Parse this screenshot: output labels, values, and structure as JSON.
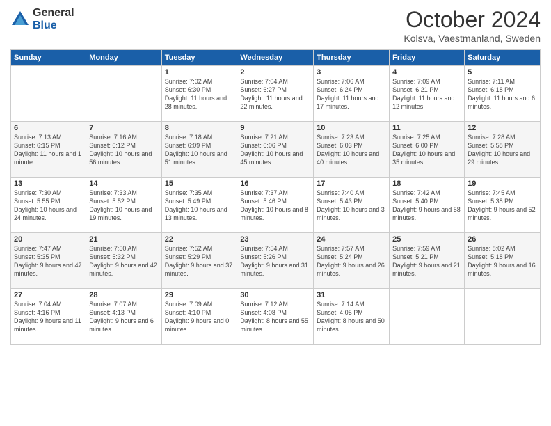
{
  "logo": {
    "general": "General",
    "blue": "Blue"
  },
  "header": {
    "month": "October 2024",
    "location": "Kolsva, Vaestmanland, Sweden"
  },
  "weekdays": [
    "Sunday",
    "Monday",
    "Tuesday",
    "Wednesday",
    "Thursday",
    "Friday",
    "Saturday"
  ],
  "weeks": [
    [
      {
        "day": "",
        "sunrise": "",
        "sunset": "",
        "daylight": ""
      },
      {
        "day": "",
        "sunrise": "",
        "sunset": "",
        "daylight": ""
      },
      {
        "day": "1",
        "sunrise": "Sunrise: 7:02 AM",
        "sunset": "Sunset: 6:30 PM",
        "daylight": "Daylight: 11 hours and 28 minutes."
      },
      {
        "day": "2",
        "sunrise": "Sunrise: 7:04 AM",
        "sunset": "Sunset: 6:27 PM",
        "daylight": "Daylight: 11 hours and 22 minutes."
      },
      {
        "day": "3",
        "sunrise": "Sunrise: 7:06 AM",
        "sunset": "Sunset: 6:24 PM",
        "daylight": "Daylight: 11 hours and 17 minutes."
      },
      {
        "day": "4",
        "sunrise": "Sunrise: 7:09 AM",
        "sunset": "Sunset: 6:21 PM",
        "daylight": "Daylight: 11 hours and 12 minutes."
      },
      {
        "day": "5",
        "sunrise": "Sunrise: 7:11 AM",
        "sunset": "Sunset: 6:18 PM",
        "daylight": "Daylight: 11 hours and 6 minutes."
      }
    ],
    [
      {
        "day": "6",
        "sunrise": "Sunrise: 7:13 AM",
        "sunset": "Sunset: 6:15 PM",
        "daylight": "Daylight: 11 hours and 1 minute."
      },
      {
        "day": "7",
        "sunrise": "Sunrise: 7:16 AM",
        "sunset": "Sunset: 6:12 PM",
        "daylight": "Daylight: 10 hours and 56 minutes."
      },
      {
        "day": "8",
        "sunrise": "Sunrise: 7:18 AM",
        "sunset": "Sunset: 6:09 PM",
        "daylight": "Daylight: 10 hours and 51 minutes."
      },
      {
        "day": "9",
        "sunrise": "Sunrise: 7:21 AM",
        "sunset": "Sunset: 6:06 PM",
        "daylight": "Daylight: 10 hours and 45 minutes."
      },
      {
        "day": "10",
        "sunrise": "Sunrise: 7:23 AM",
        "sunset": "Sunset: 6:03 PM",
        "daylight": "Daylight: 10 hours and 40 minutes."
      },
      {
        "day": "11",
        "sunrise": "Sunrise: 7:25 AM",
        "sunset": "Sunset: 6:00 PM",
        "daylight": "Daylight: 10 hours and 35 minutes."
      },
      {
        "day": "12",
        "sunrise": "Sunrise: 7:28 AM",
        "sunset": "Sunset: 5:58 PM",
        "daylight": "Daylight: 10 hours and 29 minutes."
      }
    ],
    [
      {
        "day": "13",
        "sunrise": "Sunrise: 7:30 AM",
        "sunset": "Sunset: 5:55 PM",
        "daylight": "Daylight: 10 hours and 24 minutes."
      },
      {
        "day": "14",
        "sunrise": "Sunrise: 7:33 AM",
        "sunset": "Sunset: 5:52 PM",
        "daylight": "Daylight: 10 hours and 19 minutes."
      },
      {
        "day": "15",
        "sunrise": "Sunrise: 7:35 AM",
        "sunset": "Sunset: 5:49 PM",
        "daylight": "Daylight: 10 hours and 13 minutes."
      },
      {
        "day": "16",
        "sunrise": "Sunrise: 7:37 AM",
        "sunset": "Sunset: 5:46 PM",
        "daylight": "Daylight: 10 hours and 8 minutes."
      },
      {
        "day": "17",
        "sunrise": "Sunrise: 7:40 AM",
        "sunset": "Sunset: 5:43 PM",
        "daylight": "Daylight: 10 hours and 3 minutes."
      },
      {
        "day": "18",
        "sunrise": "Sunrise: 7:42 AM",
        "sunset": "Sunset: 5:40 PM",
        "daylight": "Daylight: 9 hours and 58 minutes."
      },
      {
        "day": "19",
        "sunrise": "Sunrise: 7:45 AM",
        "sunset": "Sunset: 5:38 PM",
        "daylight": "Daylight: 9 hours and 52 minutes."
      }
    ],
    [
      {
        "day": "20",
        "sunrise": "Sunrise: 7:47 AM",
        "sunset": "Sunset: 5:35 PM",
        "daylight": "Daylight: 9 hours and 47 minutes."
      },
      {
        "day": "21",
        "sunrise": "Sunrise: 7:50 AM",
        "sunset": "Sunset: 5:32 PM",
        "daylight": "Daylight: 9 hours and 42 minutes."
      },
      {
        "day": "22",
        "sunrise": "Sunrise: 7:52 AM",
        "sunset": "Sunset: 5:29 PM",
        "daylight": "Daylight: 9 hours and 37 minutes."
      },
      {
        "day": "23",
        "sunrise": "Sunrise: 7:54 AM",
        "sunset": "Sunset: 5:26 PM",
        "daylight": "Daylight: 9 hours and 31 minutes."
      },
      {
        "day": "24",
        "sunrise": "Sunrise: 7:57 AM",
        "sunset": "Sunset: 5:24 PM",
        "daylight": "Daylight: 9 hours and 26 minutes."
      },
      {
        "day": "25",
        "sunrise": "Sunrise: 7:59 AM",
        "sunset": "Sunset: 5:21 PM",
        "daylight": "Daylight: 9 hours and 21 minutes."
      },
      {
        "day": "26",
        "sunrise": "Sunrise: 8:02 AM",
        "sunset": "Sunset: 5:18 PM",
        "daylight": "Daylight: 9 hours and 16 minutes."
      }
    ],
    [
      {
        "day": "27",
        "sunrise": "Sunrise: 7:04 AM",
        "sunset": "Sunset: 4:16 PM",
        "daylight": "Daylight: 9 hours and 11 minutes."
      },
      {
        "day": "28",
        "sunrise": "Sunrise: 7:07 AM",
        "sunset": "Sunset: 4:13 PM",
        "daylight": "Daylight: 9 hours and 6 minutes."
      },
      {
        "day": "29",
        "sunrise": "Sunrise: 7:09 AM",
        "sunset": "Sunset: 4:10 PM",
        "daylight": "Daylight: 9 hours and 0 minutes."
      },
      {
        "day": "30",
        "sunrise": "Sunrise: 7:12 AM",
        "sunset": "Sunset: 4:08 PM",
        "daylight": "Daylight: 8 hours and 55 minutes."
      },
      {
        "day": "31",
        "sunrise": "Sunrise: 7:14 AM",
        "sunset": "Sunset: 4:05 PM",
        "daylight": "Daylight: 8 hours and 50 minutes."
      },
      {
        "day": "",
        "sunrise": "",
        "sunset": "",
        "daylight": ""
      },
      {
        "day": "",
        "sunrise": "",
        "sunset": "",
        "daylight": ""
      }
    ]
  ]
}
